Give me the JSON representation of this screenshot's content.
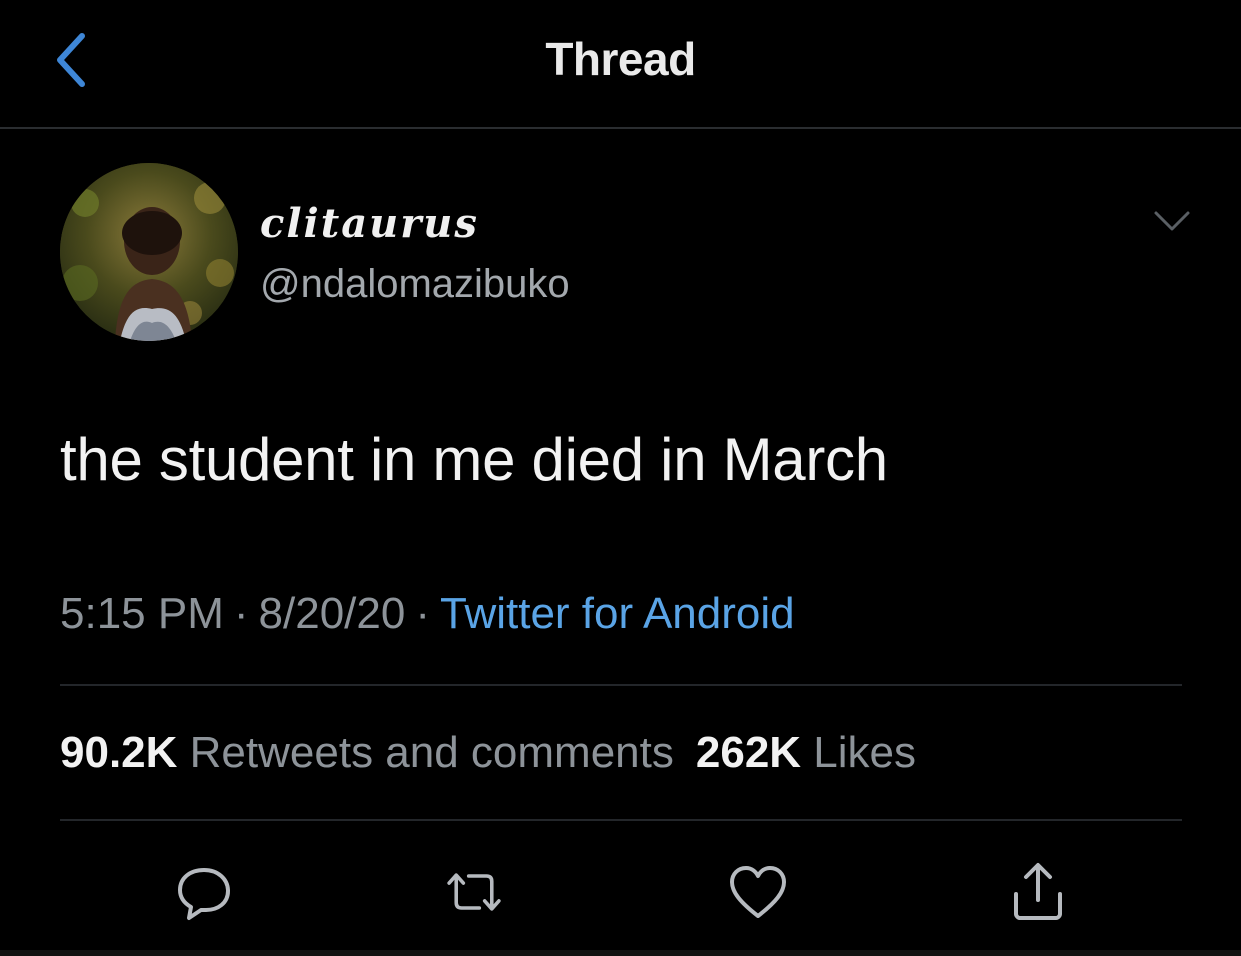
{
  "header": {
    "title": "Thread",
    "back_icon": "chevron-left-icon"
  },
  "tweet": {
    "display_name": "clitaurus",
    "handle": "@ndalomazibuko",
    "text": "the student in me died in March",
    "time": "5:15 PM",
    "date": "8/20/20",
    "separator": "·",
    "source": "Twitter for Android",
    "retweets_count": "90.2K",
    "retweets_label": "Retweets and comments",
    "likes_count": "262K",
    "likes_label": "Likes"
  },
  "actions": {
    "reply": "reply-icon",
    "retweet": "retweet-icon",
    "like": "heart-icon",
    "share": "share-icon"
  },
  "colors": {
    "background": "#000000",
    "accent": "#5aa4e6",
    "muted_text": "#8d9399",
    "divider": "#23262a"
  }
}
